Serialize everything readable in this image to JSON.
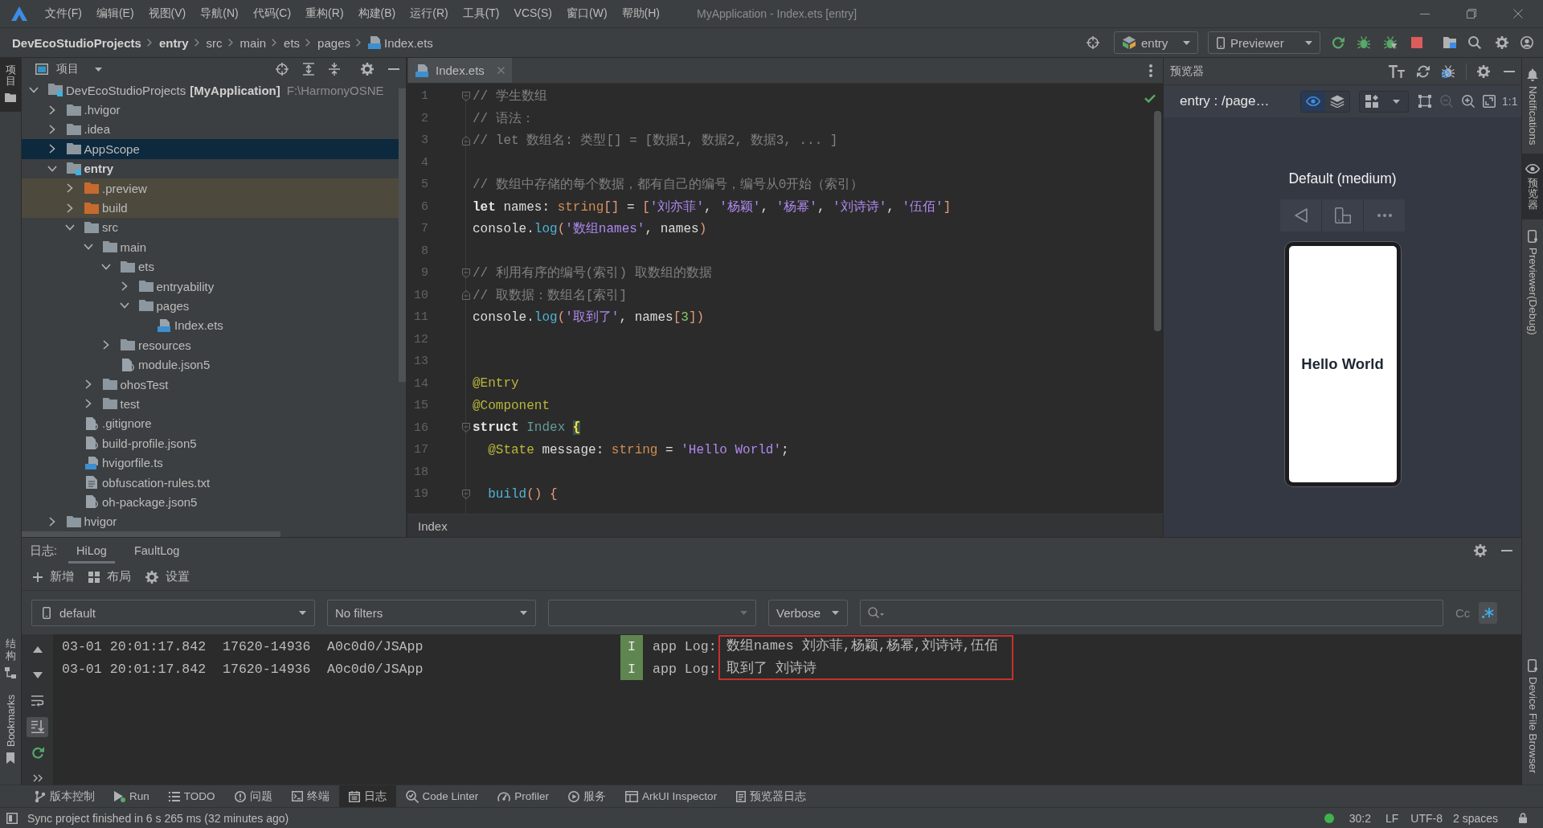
{
  "window": {
    "title": "MyApplication - Index.ets [entry]",
    "menu": [
      "文件(F)",
      "编辑(E)",
      "视图(V)",
      "导航(N)",
      "代码(C)",
      "重构(R)",
      "构建(B)",
      "运行(R)",
      "工具(T)",
      "VCS(S)",
      "窗口(W)",
      "帮助(H)"
    ]
  },
  "navigation_bar": {
    "breadcrumb": [
      {
        "label": "DevEcoStudioProjects",
        "kind": "project"
      },
      {
        "label": "entry",
        "kind": "module"
      },
      {
        "label": "src",
        "kind": "folder"
      },
      {
        "label": "main",
        "kind": "folder"
      },
      {
        "label": "ets",
        "kind": "folder"
      },
      {
        "label": "pages",
        "kind": "folder"
      },
      {
        "label": "Index.ets",
        "kind": "ets"
      }
    ],
    "run_configuration": "entry",
    "device": "Previewer"
  },
  "left_strip": [
    {
      "label": "项目",
      "kind": "project",
      "selected": true
    },
    {
      "label": "结构",
      "kind": "structure",
      "selected": false
    },
    {
      "label": "Bookmarks",
      "kind": "bookmarks",
      "selected": false
    }
  ],
  "project_panel": {
    "title": "项目",
    "tree": [
      {
        "name": "DevEcoStudioProjects",
        "kind": "project",
        "module_label": "[MyApplication]",
        "path": "F:\\HarmonyOSNE",
        "expanded": true,
        "selected": false,
        "children": [
          {
            "name": ".hvigor",
            "kind": "folder",
            "expanded": false,
            "selected": false
          },
          {
            "name": ".idea",
            "kind": "folder",
            "expanded": false,
            "selected": false
          },
          {
            "name": "AppScope",
            "kind": "folder",
            "expanded": false,
            "selected": true
          },
          {
            "name": "entry",
            "kind": "module",
            "expanded": true,
            "selected": false,
            "children": [
              {
                "name": ".preview",
                "kind": "excluded",
                "expanded": false,
                "selected": false
              },
              {
                "name": "build",
                "kind": "excluded",
                "expanded": false,
                "selected": false
              },
              {
                "name": "src",
                "kind": "folder",
                "expanded": true,
                "selected": false,
                "children": [
                  {
                    "name": "main",
                    "kind": "folder",
                    "expanded": true,
                    "selected": false,
                    "children": [
                      {
                        "name": "ets",
                        "kind": "folder",
                        "expanded": true,
                        "selected": false,
                        "children": [
                          {
                            "name": "entryability",
                            "kind": "folder",
                            "expanded": false,
                            "selected": false
                          },
                          {
                            "name": "pages",
                            "kind": "folder",
                            "expanded": true,
                            "selected": false,
                            "children": [
                              {
                                "name": "Index.ets",
                                "kind": "ets",
                                "selected": false
                              }
                            ]
                          }
                        ]
                      },
                      {
                        "name": "resources",
                        "kind": "folder",
                        "expanded": false,
                        "selected": false
                      },
                      {
                        "name": "module.json5",
                        "kind": "json5",
                        "selected": false
                      }
                    ]
                  },
                  {
                    "name": "ohosTest",
                    "kind": "folder",
                    "expanded": false,
                    "selected": false
                  },
                  {
                    "name": "test",
                    "kind": "folder",
                    "expanded": false,
                    "selected": false
                  }
                ]
              },
              {
                "name": ".gitignore",
                "kind": "gitignore",
                "selected": false
              },
              {
                "name": "build-profile.json5",
                "kind": "json5",
                "selected": false
              },
              {
                "name": "hvigorfile.ts",
                "kind": "ts",
                "selected": false
              },
              {
                "name": "obfuscation-rules.txt",
                "kind": "txt",
                "selected": false
              },
              {
                "name": "oh-package.json5",
                "kind": "json5",
                "selected": false
              }
            ]
          },
          {
            "name": "hvigor",
            "kind": "folder",
            "expanded": false,
            "selected": false
          }
        ]
      }
    ]
  },
  "editor": {
    "tab": {
      "label": "Index.ets",
      "kind": "ets",
      "selected": true
    },
    "lines": [
      {
        "number": "1",
        "kind": "fold-start",
        "tokens": [
          {
            "text": "// 学生数组",
            "kind": "comment"
          }
        ]
      },
      {
        "number": "2",
        "kind": "plain",
        "tokens": [
          {
            "text": "// 语法：",
            "kind": "comment"
          }
        ]
      },
      {
        "number": "3",
        "kind": "fold-end",
        "tokens": [
          {
            "text": "// let 数组名: 类型[] = [数据1, 数据2, 数据3, ... ]",
            "kind": "comment"
          }
        ]
      },
      {
        "number": "4",
        "kind": "plain"
      },
      {
        "number": "5",
        "kind": "plain",
        "tokens": [
          {
            "text": "// 数组中存储的每个数据，都有自己的编号，编号从0开始（索引）",
            "kind": "comment"
          }
        ]
      },
      {
        "number": "6",
        "kind": "plain",
        "tokens": [
          {
            "text": "let",
            "kind": "keyword"
          },
          {
            "text": " names: ",
            "kind": "plain"
          },
          {
            "text": "string",
            "kind": "type"
          },
          {
            "text": "[]",
            "kind": "bracket"
          },
          {
            "text": " = ",
            "kind": "plain"
          },
          {
            "text": "[",
            "kind": "bracket"
          },
          {
            "text": "'刘亦菲'",
            "kind": "string"
          },
          {
            "text": ", ",
            "kind": "plain"
          },
          {
            "text": "'杨颖'",
            "kind": "string"
          },
          {
            "text": ", ",
            "kind": "plain"
          },
          {
            "text": "'杨幂'",
            "kind": "string"
          },
          {
            "text": ", ",
            "kind": "plain"
          },
          {
            "text": "'刘诗诗'",
            "kind": "string"
          },
          {
            "text": ", ",
            "kind": "plain"
          },
          {
            "text": "'伍佰'",
            "kind": "string"
          },
          {
            "text": "]",
            "kind": "bracket"
          }
        ]
      },
      {
        "number": "7",
        "kind": "plain",
        "tokens": [
          {
            "text": "console.",
            "kind": "plain"
          },
          {
            "text": "log",
            "kind": "method"
          },
          {
            "text": "(",
            "kind": "bracket"
          },
          {
            "text": "'数组names'",
            "kind": "string"
          },
          {
            "text": ", names",
            "kind": "plain"
          },
          {
            "text": ")",
            "kind": "bracket"
          }
        ]
      },
      {
        "number": "8",
        "kind": "plain"
      },
      {
        "number": "9",
        "kind": "fold-start",
        "tokens": [
          {
            "text": "// 利用有序的编号(索引) 取数组的数据",
            "kind": "comment"
          }
        ]
      },
      {
        "number": "10",
        "kind": "fold-end",
        "tokens": [
          {
            "text": "// 取数据：数组名[索引]",
            "kind": "comment"
          }
        ]
      },
      {
        "number": "11",
        "kind": "plain",
        "tokens": [
          {
            "text": "console.",
            "kind": "plain"
          },
          {
            "text": "log",
            "kind": "method"
          },
          {
            "text": "(",
            "kind": "bracket"
          },
          {
            "text": "'取到了'",
            "kind": "string"
          },
          {
            "text": ", names",
            "kind": "plain"
          },
          {
            "text": "[",
            "kind": "bracket"
          },
          {
            "text": "3",
            "kind": "number"
          },
          {
            "text": "])",
            "kind": "bracket"
          }
        ]
      },
      {
        "number": "12",
        "kind": "plain"
      },
      {
        "number": "13",
        "kind": "plain"
      },
      {
        "number": "14",
        "kind": "plain",
        "tokens": [
          {
            "text": "@Entry",
            "kind": "decorator"
          }
        ]
      },
      {
        "number": "15",
        "kind": "plain",
        "tokens": [
          {
            "text": "@Component",
            "kind": "decorator"
          }
        ]
      },
      {
        "number": "16",
        "kind": "fold-start",
        "tokens": [
          {
            "text": "struct ",
            "kind": "keyword"
          },
          {
            "text": "Index ",
            "kind": "class"
          },
          {
            "text": "{",
            "kind": "brace_match"
          }
        ]
      },
      {
        "number": "17",
        "kind": "plain",
        "tokens": [
          {
            "text": "  @State",
            "kind": "decorator"
          },
          {
            "text": " message: ",
            "kind": "plain"
          },
          {
            "text": "string",
            "kind": "type"
          },
          {
            "text": " = ",
            "kind": "plain"
          },
          {
            "text": "'Hello World'",
            "kind": "string"
          },
          {
            "text": ";",
            "kind": "plain"
          }
        ]
      },
      {
        "number": "18",
        "kind": "plain"
      },
      {
        "number": "19",
        "kind": "fold-start",
        "tokens": [
          {
            "text": "  build",
            "kind": "method"
          },
          {
            "text": "() {",
            "kind": "bracket"
          }
        ]
      }
    ],
    "breadcrumb": "Index"
  },
  "previewer": {
    "title": "预览器",
    "page": "entry : /page…",
    "view_modes": [
      {
        "kind": "inspect",
        "selected": true
      },
      {
        "kind": "layers",
        "selected": false
      }
    ],
    "zoom_out": {
      "disabled": true
    },
    "scale_label": "1:1",
    "device_name": "Default (medium)",
    "screen_text": "Hello World"
  },
  "right_strip": [
    {
      "label": "Notifications",
      "kind": "notifications",
      "selected": false
    },
    {
      "label": "预览器",
      "kind": "previewer",
      "selected": true
    },
    {
      "label": "Previewer(Debug)",
      "kind": "debug-previewer",
      "selected": false
    },
    {
      "label": "Device File Browser",
      "kind": "device-files",
      "selected": false
    }
  ],
  "log_panel": {
    "label": "日志:",
    "tabs": [
      {
        "label": "HiLog",
        "selected": true
      },
      {
        "label": "FaultLog",
        "selected": false
      }
    ],
    "actions": [
      {
        "kind": "add",
        "label": "新增"
      },
      {
        "kind": "layout",
        "label": "布局"
      },
      {
        "kind": "settings",
        "label": "设置"
      }
    ],
    "filters": {
      "device": "default",
      "filter": "No filters",
      "level": "Verbose"
    },
    "search_options": [
      {
        "kind": "match-case",
        "label": "Cc",
        "selected": false
      },
      {
        "kind": "regex",
        "selected": true
      }
    ],
    "autoscroll": true,
    "messages_outlined": true,
    "entries": [
      {
        "time": "03-01 20:01:17.842",
        "pid": "17620-14936",
        "tag": "A0c0d0/JSApp",
        "level": "I",
        "color": "#5f8650",
        "source": "app Log:",
        "message": "数组names 刘亦菲,杨颖,杨幂,刘诗诗,伍佰"
      },
      {
        "time": "03-01 20:01:17.842",
        "pid": "17620-14936",
        "tag": "A0c0d0/JSApp",
        "level": "I",
        "color": "#5f8650",
        "source": "app Log:",
        "message": "取到了 刘诗诗"
      }
    ]
  },
  "tool_tabs": [
    {
      "label": "版本控制",
      "kind": "vcs",
      "selected": false
    },
    {
      "label": "Run",
      "kind": "run",
      "selected": false
    },
    {
      "label": "TODO",
      "kind": "todo",
      "selected": false
    },
    {
      "label": "问题",
      "kind": "problems",
      "selected": false
    },
    {
      "label": "终端",
      "kind": "terminal",
      "selected": false
    },
    {
      "label": "日志",
      "kind": "log",
      "selected": true
    },
    {
      "label": "Code Linter",
      "kind": "linter",
      "selected": false
    },
    {
      "label": "Profiler",
      "kind": "profiler",
      "selected": false
    },
    {
      "label": "服务",
      "kind": "services",
      "selected": false
    },
    {
      "label": "ArkUI Inspector",
      "kind": "inspector",
      "selected": false
    },
    {
      "label": "预览器日志",
      "kind": "preview-log",
      "selected": false
    }
  ],
  "status_bar": {
    "message": "Sync project finished in 6 s 265 ms (32 minutes ago)",
    "position": "30:2",
    "line_separator": "LF",
    "encoding": "UTF-8",
    "indent": "2 spaces"
  }
}
